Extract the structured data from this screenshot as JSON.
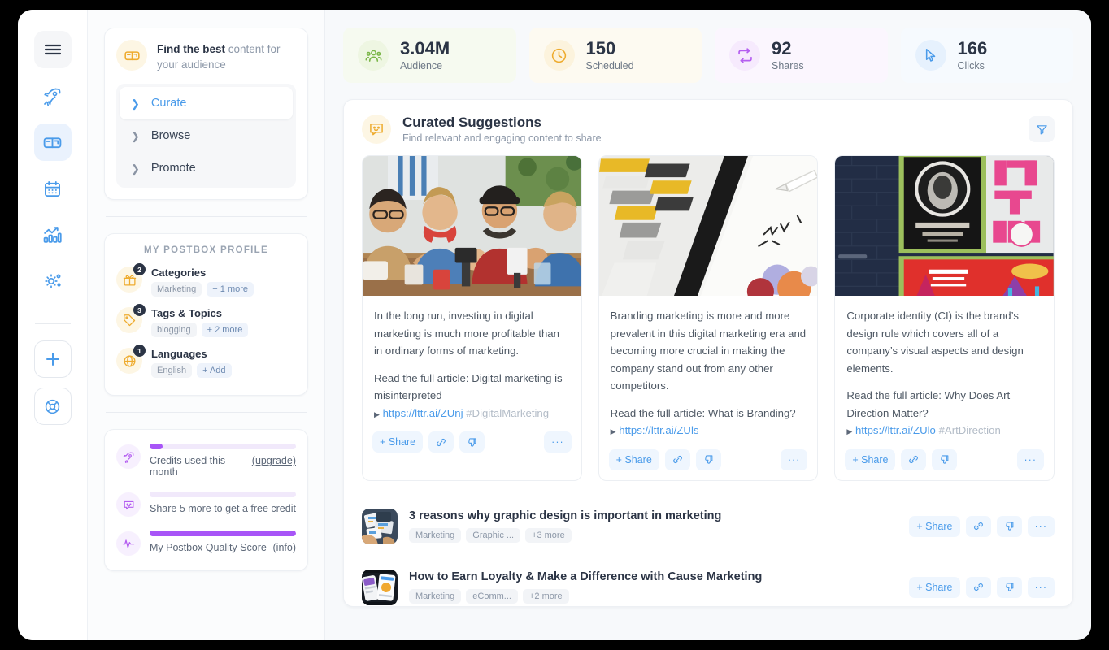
{
  "rail": {
    "items": [
      {
        "name": "menu-icon",
        "label": "Menu"
      },
      {
        "name": "rocket-icon",
        "label": "Promote"
      },
      {
        "name": "mailbox-icon",
        "label": "Postbox"
      },
      {
        "name": "calendar-icon",
        "label": "Calendar"
      },
      {
        "name": "analytics-icon",
        "label": "Analytics"
      },
      {
        "name": "settings-icon",
        "label": "Settings"
      }
    ],
    "bottom": [
      {
        "name": "plus-icon",
        "label": "Create"
      },
      {
        "name": "help-icon",
        "label": "Help"
      }
    ]
  },
  "panel": {
    "find_strong": "Find the best",
    "find_rest": " content for your audience",
    "nav": [
      {
        "label": "Curate",
        "active": true
      },
      {
        "label": "Browse",
        "active": false
      },
      {
        "label": "Promote",
        "active": false
      }
    ],
    "profile_title": "MY POSTBOX PROFILE",
    "profile": [
      {
        "name": "Categories",
        "badge": "2",
        "chip": "Marketing",
        "more": "+ 1 more",
        "icon": "gift-icon"
      },
      {
        "name": "Tags & Topics",
        "badge": "3",
        "chip": "blogging",
        "more": "+ 2 more",
        "icon": "tag-icon"
      },
      {
        "name": "Languages",
        "badge": "1",
        "chip": "English",
        "more": "+ Add",
        "icon": "globe-icon"
      }
    ],
    "credits": [
      {
        "label": "Credits used this month",
        "action": "(upgrade)",
        "percent": 9,
        "icon": "rocket-icon"
      },
      {
        "label": "Share 5 more to get a free credit",
        "action": "",
        "percent": 0,
        "icon": "chat-icon"
      },
      {
        "label": "My Postbox Quality Score",
        "action": "(info)",
        "percent": 100,
        "icon": "pulse-icon"
      }
    ]
  },
  "stats": [
    {
      "value": "3.04M",
      "label": "Audience",
      "icon": "audience-icon",
      "bg": "#f6faf0",
      "icon_bg": "#eef6e2",
      "color": "#7ab648"
    },
    {
      "value": "150",
      "label": "Scheduled",
      "icon": "clock-icon",
      "bg": "#fdfaf1",
      "icon_bg": "#fcf3dd",
      "color": "#eeab2e"
    },
    {
      "value": "92",
      "label": "Shares",
      "icon": "share-icon",
      "bg": "#fbf6fe",
      "icon_bg": "#f6eafd",
      "color": "#b45df0"
    },
    {
      "value": "166",
      "label": "Clicks",
      "icon": "cursor-icon",
      "bg": "#f6fafe",
      "icon_bg": "#e6f1fd",
      "color": "#4a9bea"
    }
  ],
  "curated": {
    "title": "Curated Suggestions",
    "subtitle": "Find relevant and engaging content to share",
    "filter_icon": "filter-icon"
  },
  "suggestions": [
    {
      "image": "people-at-table-photo",
      "text": "In the long run, investing in digital marketing is much more profitable than in ordinary forms of marketing.",
      "read_more": "Read the full article: Digital marketing is misinterpreted",
      "link": "https://lttr.ai/ZUnj",
      "hashtag": "#DigitalMarketing",
      "share_label": "+ Share"
    },
    {
      "image": "color-swatch-photo",
      "text": "Branding marketing is more and more prevalent in this digital marketing era and becoming more crucial in making the company stand out from any other competitors.",
      "read_more": "Read the full article: What is Branding?",
      "link": "https://lttr.ai/ZUls",
      "hashtag": "",
      "share_label": "+ Share"
    },
    {
      "image": "street-posters-photo",
      "text": "Corporate identity (CI) is the brand’s design rule which covers all of a company’s visual aspects and design elements.",
      "read_more": "Read the full article: Why Does Art Direction Matter?",
      "link": "https://lttr.ai/ZUlo",
      "hashtag": "#ArtDirection",
      "share_label": "+ Share"
    }
  ],
  "list_rows": [
    {
      "thumb": "design-papers-photo",
      "title": "3 reasons why graphic design is important in marketing",
      "chips": [
        "Marketing",
        "Graphic ...",
        "+3 more"
      ],
      "share_label": "+ Share"
    },
    {
      "thumb": "phone-screens-photo",
      "title": "How to Earn Loyalty & Make a Difference with Cause Marketing",
      "chips": [
        "Marketing",
        "eComm...",
        "+2 more"
      ],
      "share_label": "+ Share"
    }
  ],
  "icons": {
    "link_icon": "link-icon",
    "dislike_icon": "thumbs-down-icon",
    "more_icon": "more-dots-icon"
  }
}
